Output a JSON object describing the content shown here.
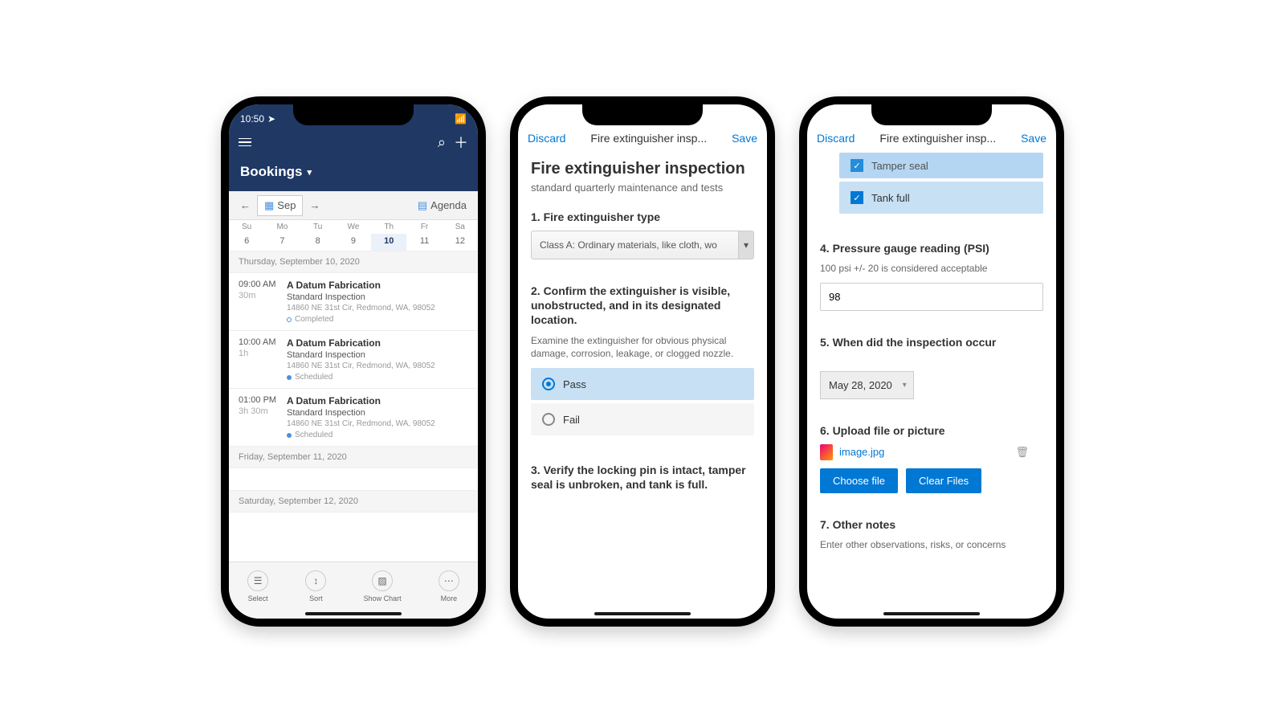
{
  "phone1": {
    "time": "10:50",
    "title": "Bookings",
    "month": "Sep",
    "agenda": "Agenda",
    "weekdays": [
      "Su",
      "Mo",
      "Tu",
      "We",
      "Th",
      "Fr",
      "Sa"
    ],
    "dates": [
      "6",
      "7",
      "8",
      "9",
      "10",
      "11",
      "12"
    ],
    "sections": [
      {
        "header": "Thursday, September 10, 2020",
        "items": [
          {
            "time": "09:00 AM",
            "dur": "30m",
            "title": "A Datum Fabrication",
            "sub": "Standard Inspection",
            "addr": "14860 NE 31st Cir, Redmond, WA, 98052",
            "status": "Completed",
            "dot": "c1"
          },
          {
            "time": "10:00 AM",
            "dur": "1h",
            "title": "A Datum Fabrication",
            "sub": "Standard Inspection",
            "addr": "14860 NE 31st Cir, Redmond, WA, 98052",
            "status": "Scheduled",
            "dot": "c2"
          },
          {
            "time": "01:00 PM",
            "dur": "3h 30m",
            "title": "A Datum Fabrication",
            "sub": "Standard Inspection",
            "addr": "14860 NE 31st Cir, Redmond, WA, 98052",
            "status": "Scheduled",
            "dot": "c2"
          }
        ]
      },
      {
        "header": "Friday, September 11, 2020",
        "items": []
      },
      {
        "header": "Saturday, September 12, 2020",
        "items": []
      }
    ],
    "bottom": {
      "select": "Select",
      "sort": "Sort",
      "chart": "Show Chart",
      "more": "More"
    }
  },
  "phone2": {
    "discard": "Discard",
    "save": "Save",
    "header": "Fire extinguisher insp...",
    "title": "Fire extinguisher inspection",
    "subtitle": "standard quarterly maintenance and tests",
    "q1": {
      "label": "1. Fire extinguisher type",
      "value": "Class A: Ordinary materials, like cloth, wo"
    },
    "q2": {
      "label": "2. Confirm the extinguisher is visible, unobstructed, and in its designated location.",
      "help": "Examine the extinguisher for obvious physical damage, corrosion, leakage, or clogged nozzle.",
      "opt1": "Pass",
      "opt2": "Fail"
    },
    "q3": {
      "label": "3. Verify the locking pin is intact, tamper seal is unbroken, and tank is full."
    }
  },
  "phone3": {
    "discard": "Discard",
    "save": "Save",
    "header": "Fire extinguisher insp...",
    "chk1": "Tamper seal",
    "chk2": "Tank full",
    "q4": {
      "label": "4. Pressure gauge reading (PSI)",
      "help": "100 psi +/- 20 is considered acceptable",
      "value": "98"
    },
    "q5": {
      "label": "5. When did the inspection occur",
      "value": "May 28, 2020"
    },
    "q6": {
      "label": "6. Upload file or picture",
      "file": "image.jpg",
      "choose": "Choose file",
      "clear": "Clear Files"
    },
    "q7": {
      "label": "7. Other notes",
      "help": "Enter other observations, risks, or concerns"
    }
  }
}
